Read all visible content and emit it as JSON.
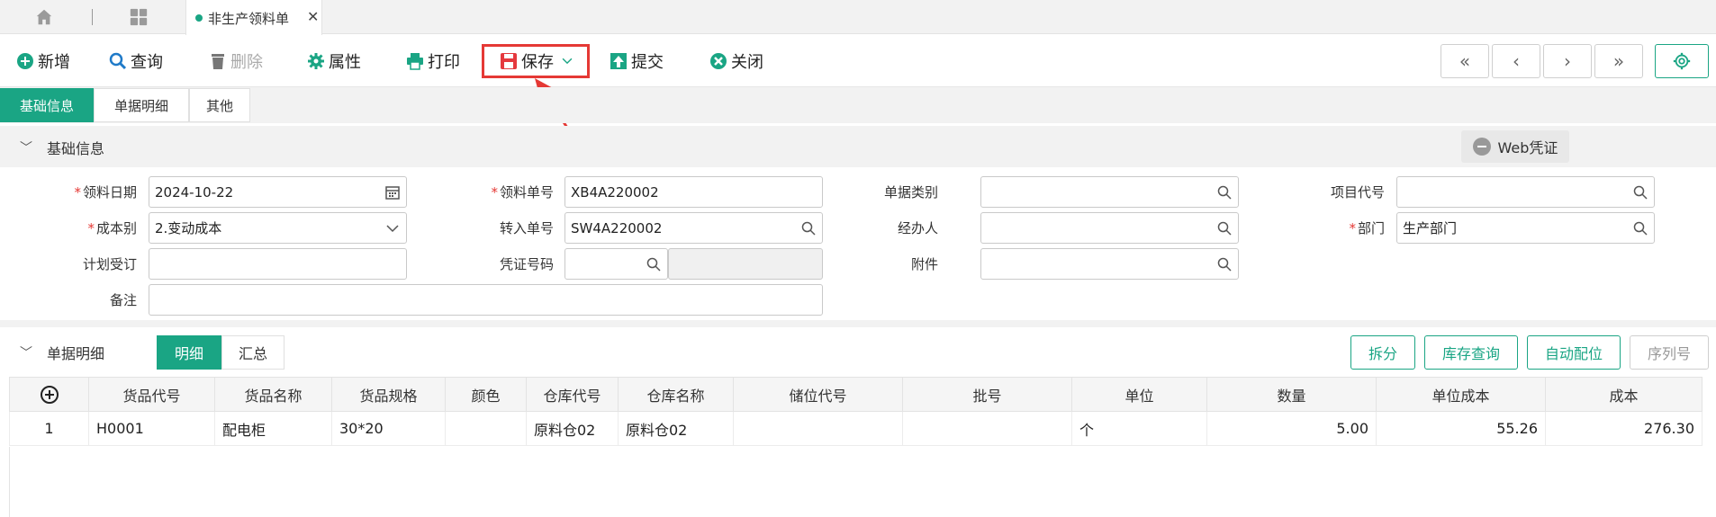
{
  "tabstrip": {
    "active_tab": "非生产领料单",
    "close": "✕"
  },
  "toolbar": {
    "new": "新增",
    "query": "查询",
    "delete": "删除",
    "properties": "属性",
    "print": "打印",
    "save": "保存",
    "submit": "提交",
    "close": "关闭",
    "first": "«",
    "prev": "‹",
    "next": "›",
    "last": "»"
  },
  "section_tabs": [
    "基础信息",
    "单据明细",
    "其他"
  ],
  "panel": {
    "title": "基础信息",
    "web_voucher": "Web凭证"
  },
  "form": {
    "date_label": "领料日期",
    "date_value": "2024-10-22",
    "doc_no_label": "领料单号",
    "doc_no_value": "XB4A220002",
    "doc_type_label": "单据类别",
    "doc_type_value": "",
    "project_label": "项目代号",
    "project_value": "",
    "cost_label": "成本别",
    "cost_value": "2.变动成本",
    "transfer_label": "转入单号",
    "transfer_value": "SW4A220002",
    "handler_label": "经办人",
    "handler_value": "",
    "dept_label": "部门",
    "dept_value": "生产部门",
    "plan_label": "计划受订",
    "plan_value": "",
    "voucher_label": "凭证号码",
    "voucher_value": "",
    "attach_label": "附件",
    "attach_value": "",
    "remark_label": "备注",
    "remark_value": ""
  },
  "detail": {
    "title": "单据明细",
    "sub_tabs": [
      "明细",
      "汇总"
    ],
    "actions": [
      "拆分",
      "库存查询",
      "自动配位",
      "序列号"
    ]
  },
  "grid": {
    "headers": [
      "货品代号",
      "货品名称",
      "货品规格",
      "颜色",
      "仓库代号",
      "仓库名称",
      "储位代号",
      "批号",
      "单位",
      "数量",
      "单位成本",
      "成本"
    ],
    "rows": [
      {
        "idx": "1",
        "code": "H0001",
        "name": "配电柜",
        "spec": "30*20",
        "color": "",
        "wh_code": "原料仓02",
        "wh_name": "原料仓02",
        "loc": "",
        "batch": "",
        "unit": "个",
        "qty": "5.00",
        "unit_cost": "55.26",
        "cost": "276.30"
      }
    ]
  },
  "colors": {
    "accent": "#1aa584",
    "highlight": "#e53935"
  }
}
